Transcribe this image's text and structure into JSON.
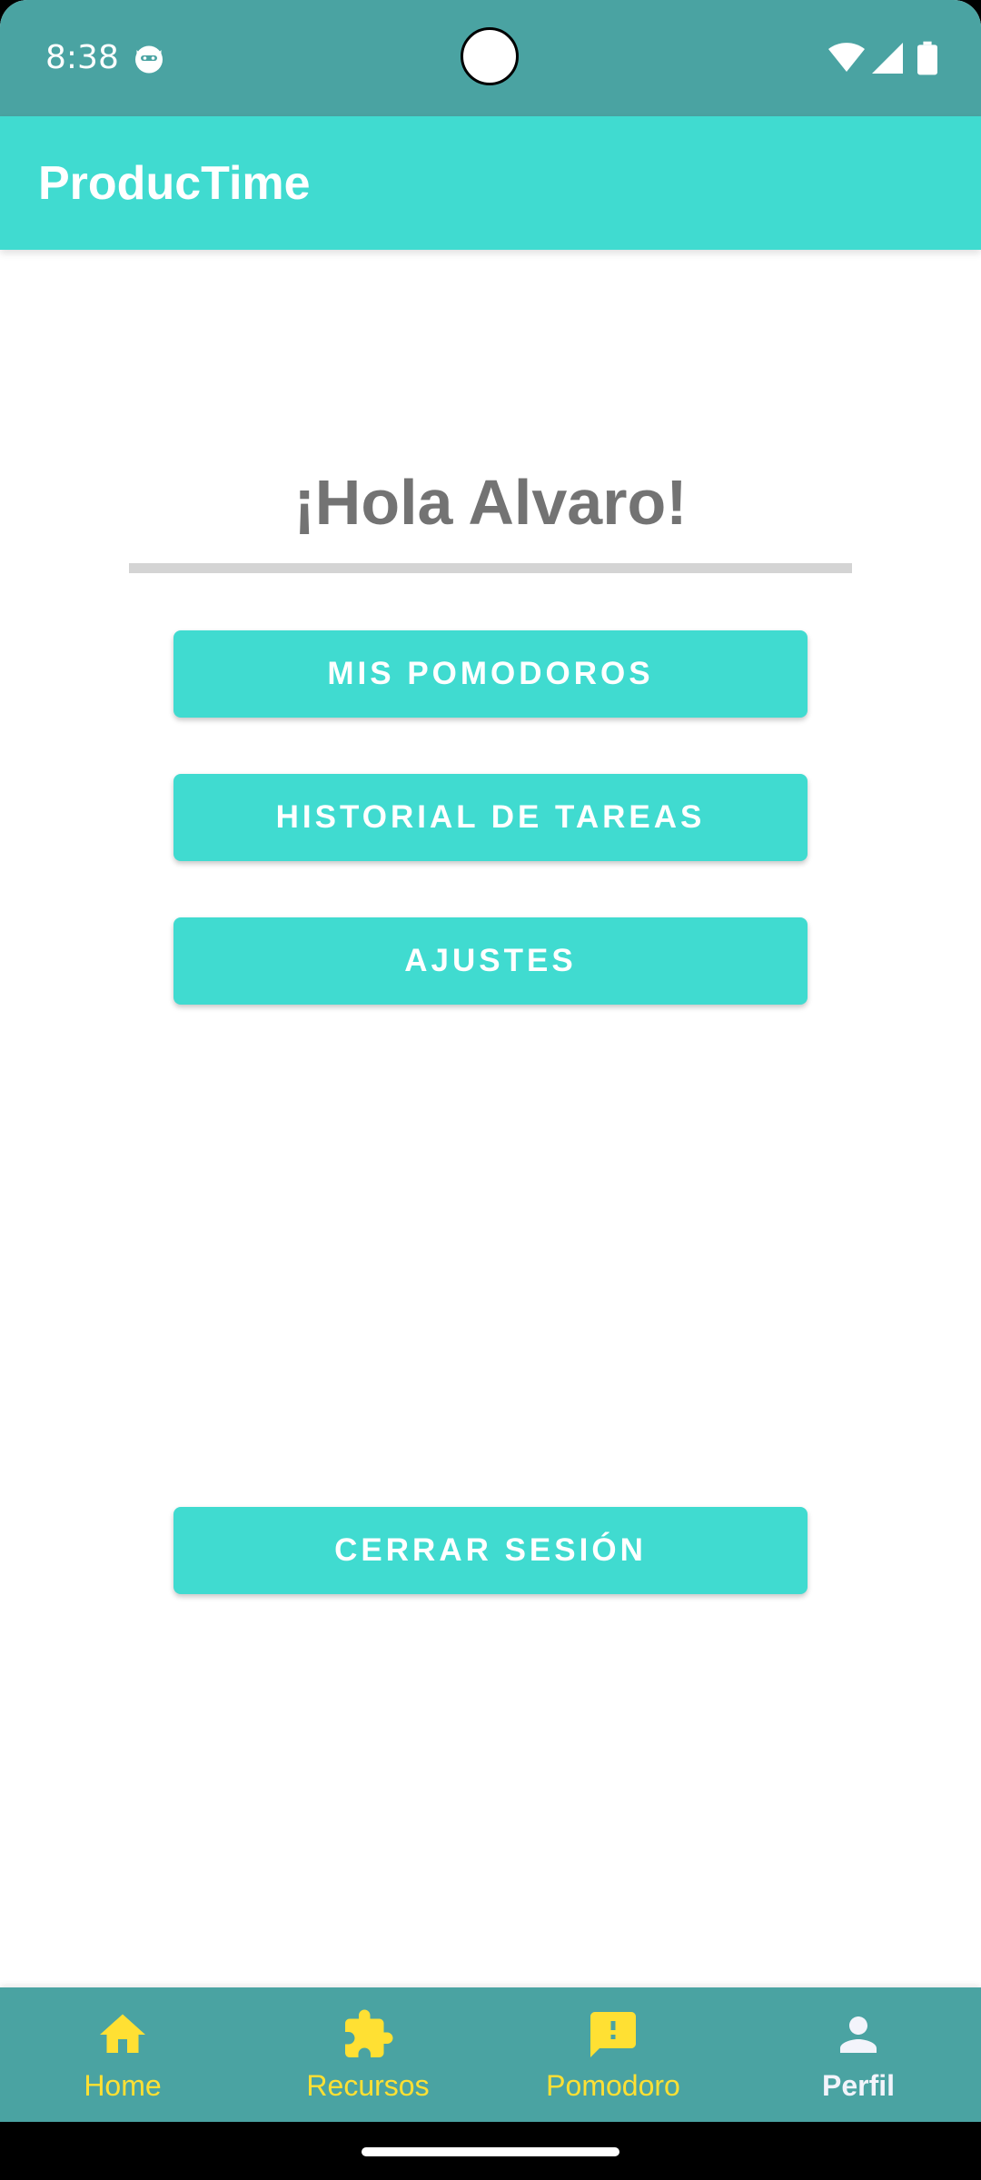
{
  "status_bar": {
    "time": "8:38",
    "app_icon": "cat-face-icon",
    "wifi_icon": "wifi-icon",
    "signal_icon": "cell-signal-icon",
    "battery_icon": "battery-icon"
  },
  "app_bar": {
    "title": "ProducTime"
  },
  "main": {
    "greeting": "¡Hola Alvaro!",
    "buttons": {
      "pomodoros": "MIS POMODOROS",
      "historial": "HISTORIAL DE TAREAS",
      "ajustes": "AJUSTES",
      "cerrar_sesion": "CERRAR SESIÓN"
    }
  },
  "bottom_nav": {
    "items": [
      {
        "label": "Home",
        "icon": "home-icon"
      },
      {
        "label": "Recursos",
        "icon": "puzzle-icon"
      },
      {
        "label": "Pomodoro",
        "icon": "alert-message-icon"
      },
      {
        "label": "Perfil",
        "icon": "person-icon"
      }
    ],
    "active": "Perfil"
  },
  "colors": {
    "status_bar": "#4aa3a2",
    "primary": "#40dbd0",
    "nav_background": "#4aa3a2",
    "nav_icon_inactive": "#ffe033",
    "nav_active": "#f3f4fb",
    "greeting_text": "#737373",
    "divider": "#d4d4d4"
  }
}
